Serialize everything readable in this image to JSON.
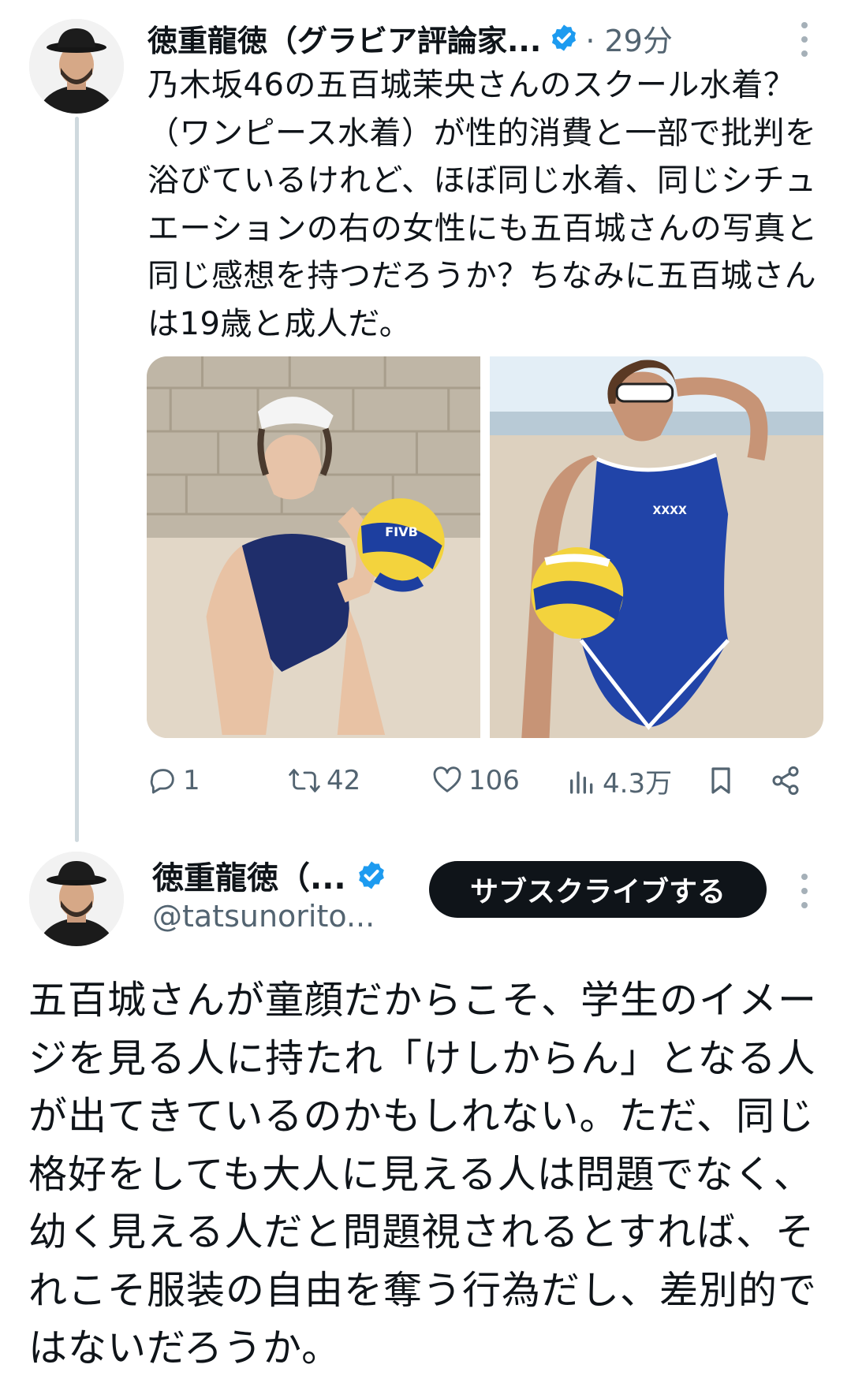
{
  "tweet1": {
    "author_name": "徳重龍徳（グラビア評論家...",
    "time": "· 29分",
    "text": "乃木坂46の五百城茉央さんのスクール水着？（ワンピース水着）が性的消費と一部で批判を浴びているけれど、ほぼ同じ水着、同じシチュエーションの右の女性にも五百城さんの写真と同じ感想を持つだろうか？ちなみに五百城さんは19歳と成人だ。",
    "media": [
      {
        "icon": "photo-left",
        "ball_label": "FIVB"
      },
      {
        "icon": "photo-right",
        "suit_label": "XXXX"
      }
    ],
    "stats": {
      "replies": "1",
      "retweets": "42",
      "likes": "106",
      "views": "4.3万"
    }
  },
  "tweet2": {
    "author_name": "徳重龍徳（...",
    "handle": "@tatsunorito...",
    "subscribe_label": "サブスクライブする",
    "text": "五百城さんが童顔だからこそ、学生のイメージを見る人に持たれ「けしからん」となる人が出てきているのかもしれない。ただ、同じ格好をしても大人に見える人は問題でなく、幼く見える人だと問題視されるとすれば、それこそ服装の自由を奪う行為だし、差別的ではないだろうか。"
  },
  "colors": {
    "text": "#0f1419",
    "secondary": "#536471",
    "verified": "#1d9bf0",
    "button_bg": "#0f1419"
  }
}
